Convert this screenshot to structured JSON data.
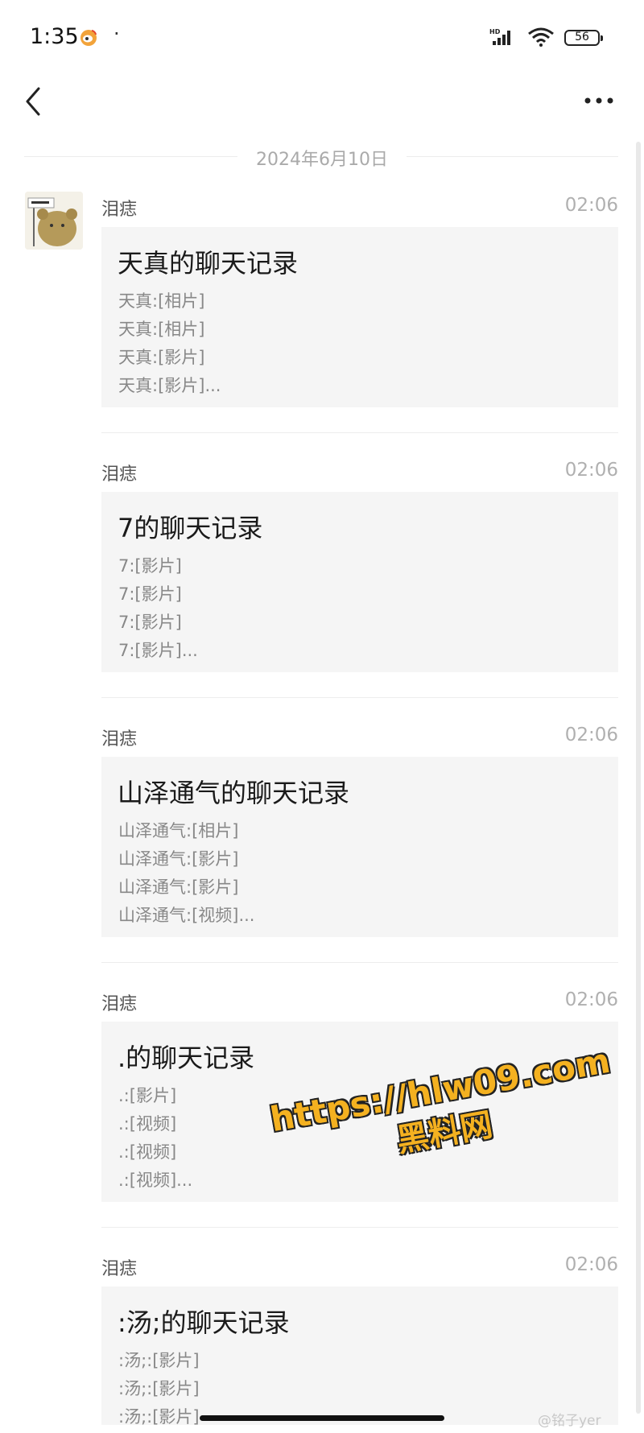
{
  "status_bar": {
    "time": "1:35",
    "dot": "·",
    "battery": "56"
  },
  "nav": {
    "back_icon": "chevron-left-icon",
    "more_icon": "more-horizontal-icon"
  },
  "date_separator": "2024年6月10日",
  "messages": [
    {
      "sender": "泪痣",
      "time": "02:06",
      "title": "天真的聊天记录",
      "lines": [
        "天真:[相片]",
        "天真:[相片]",
        "天真:[影片]",
        "天真:[影片]..."
      ]
    },
    {
      "sender": "泪痣",
      "time": "02:06",
      "title": "7的聊天记录",
      "lines": [
        "7:[影片]",
        "7:[影片]",
        "7:[影片]",
        "7:[影片]..."
      ]
    },
    {
      "sender": "泪痣",
      "time": "02:06",
      "title": "山泽通气的聊天记录",
      "lines": [
        "山泽通气:[相片]",
        "山泽通气:[影片]",
        "山泽通气:[影片]",
        "山泽通气:[视频]..."
      ]
    },
    {
      "sender": "泪痣",
      "time": "02:06",
      "title": ".的聊天记录",
      "lines": [
        ".:[影片]",
        ".:[视频]",
        ".:[视频]",
        ".:[视频]..."
      ]
    },
    {
      "sender": "泪痣",
      "time": "02:06",
      "title": ":汤;的聊天记录",
      "lines": [
        ":汤;:[影片]",
        ":汤;:[影片]",
        ":汤;:[影片]"
      ]
    }
  ],
  "watermark": {
    "url": "https://hlw09.com",
    "name": "黑料网"
  },
  "corner_watermark": "@铭子yer"
}
